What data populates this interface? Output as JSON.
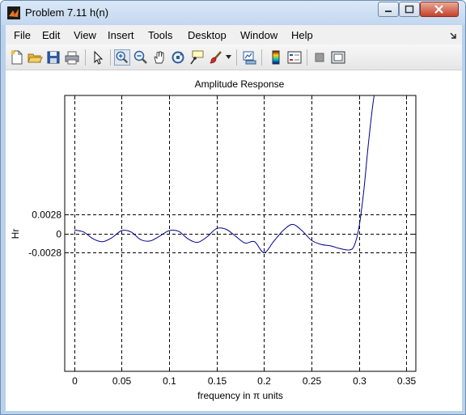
{
  "window": {
    "title": "Problem 7.11 h(n)"
  },
  "menu": {
    "items": [
      {
        "label": "File"
      },
      {
        "label": "Edit"
      },
      {
        "label": "View"
      },
      {
        "label": "Insert"
      },
      {
        "label": "Tools"
      },
      {
        "label": "Desktop"
      },
      {
        "label": "Window"
      },
      {
        "label": "Help"
      }
    ]
  },
  "toolbar": {
    "buttons": [
      {
        "icon": "new-figure-icon"
      },
      {
        "icon": "open-file-icon"
      },
      {
        "icon": "save-icon"
      },
      {
        "icon": "print-icon"
      },
      {
        "icon": "edit-plot-arrow-icon"
      },
      {
        "icon": "zoom-in-icon",
        "pressed": true
      },
      {
        "icon": "zoom-out-icon"
      },
      {
        "icon": "pan-hand-icon"
      },
      {
        "icon": "rotate-3d-icon"
      },
      {
        "icon": "data-cursor-icon"
      },
      {
        "icon": "brush-icon"
      },
      {
        "icon": "link-plot-icon"
      },
      {
        "icon": "colorbar-icon"
      },
      {
        "icon": "legend-icon"
      },
      {
        "icon": "hide-plot-tools-icon"
      },
      {
        "icon": "show-plot-tools-icon"
      }
    ]
  },
  "chart_data": {
    "type": "line",
    "title": "Amplitude Response",
    "xlabel": "frequency in π units",
    "ylabel": "Hr",
    "xlim": [
      -0.01,
      0.36
    ],
    "ylim": [
      -0.02,
      0.02
    ],
    "xticks": [
      0,
      0.05,
      0.1,
      0.15,
      0.2,
      0.25,
      0.3,
      0.35
    ],
    "xtick_labels": [
      "0",
      "0.05",
      "0.1",
      "0.15",
      "0.2",
      "0.25",
      "0.3",
      "0.35"
    ],
    "yticks": [
      -0.0028,
      0,
      0.0028
    ],
    "ytick_labels": [
      "-0.0028",
      "0",
      "0.0028"
    ],
    "grid": "dashed",
    "series": [
      {
        "color": "#00008b",
        "x": [
          0,
          0.01,
          0.02,
          0.03,
          0.04,
          0.05,
          0.06,
          0.07,
          0.08,
          0.09,
          0.1,
          0.11,
          0.12,
          0.13,
          0.14,
          0.15,
          0.16,
          0.17,
          0.18,
          0.19,
          0.2,
          0.21,
          0.22,
          0.23,
          0.24,
          0.25,
          0.26,
          0.27,
          0.28,
          0.29,
          0.295,
          0.3,
          0.305,
          0.31,
          0.315,
          0.32
        ],
        "y": [
          0.0005,
          0.0002,
          -0.0008,
          -0.0012,
          -0.0006,
          0.0004,
          0.0002,
          -0.0009,
          -0.0011,
          -0.0004,
          0.0004,
          0.0003,
          -0.0008,
          -0.0013,
          -0.0005,
          0.0007,
          0.0006,
          -0.0004,
          -0.0014,
          -0.0012,
          -0.0028,
          -0.0012,
          0.0004,
          0.0013,
          0.0004,
          -0.001,
          -0.0016,
          -0.0018,
          -0.0022,
          -0.0024,
          -0.0018,
          0.0008,
          0.006,
          0.013,
          0.019,
          0.023
        ]
      }
    ]
  }
}
